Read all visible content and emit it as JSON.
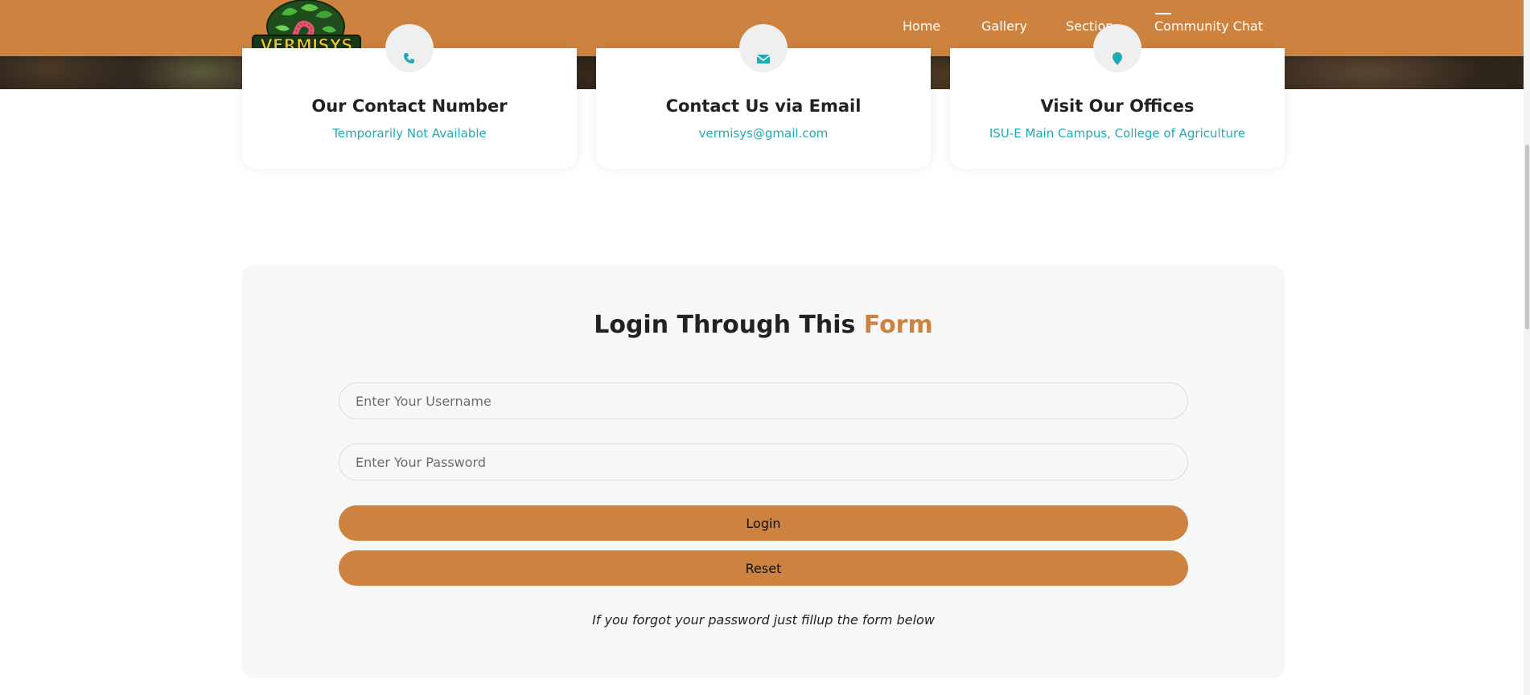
{
  "brand": {
    "name": "VERMISYS",
    "accent_color": "#cd833f",
    "link_color": "#1faab5"
  },
  "nav": {
    "items": [
      {
        "label": "Home"
      },
      {
        "label": "Gallery"
      },
      {
        "label": "Section"
      },
      {
        "label": "Community Chat"
      }
    ],
    "active": "Community Chat"
  },
  "contact_cards": [
    {
      "icon": "phone-icon",
      "title": "Our Contact Number",
      "text": "Temporarily Not Available"
    },
    {
      "icon": "envelope-icon",
      "title": "Contact Us via Email",
      "text": "vermisys@gmail.com"
    },
    {
      "icon": "map-pin-icon",
      "title": "Visit Our Offices",
      "text": "ISU-E Main Campus, College of Agriculture"
    }
  ],
  "login": {
    "title_main": "Login Through This",
    "title_accent": "Form",
    "username_placeholder": "Enter Your Username",
    "password_placeholder": "Enter Your Password",
    "login_label": "Login",
    "reset_label": "Reset",
    "forgot_text": "If you forgot your password just fillup the form below"
  }
}
